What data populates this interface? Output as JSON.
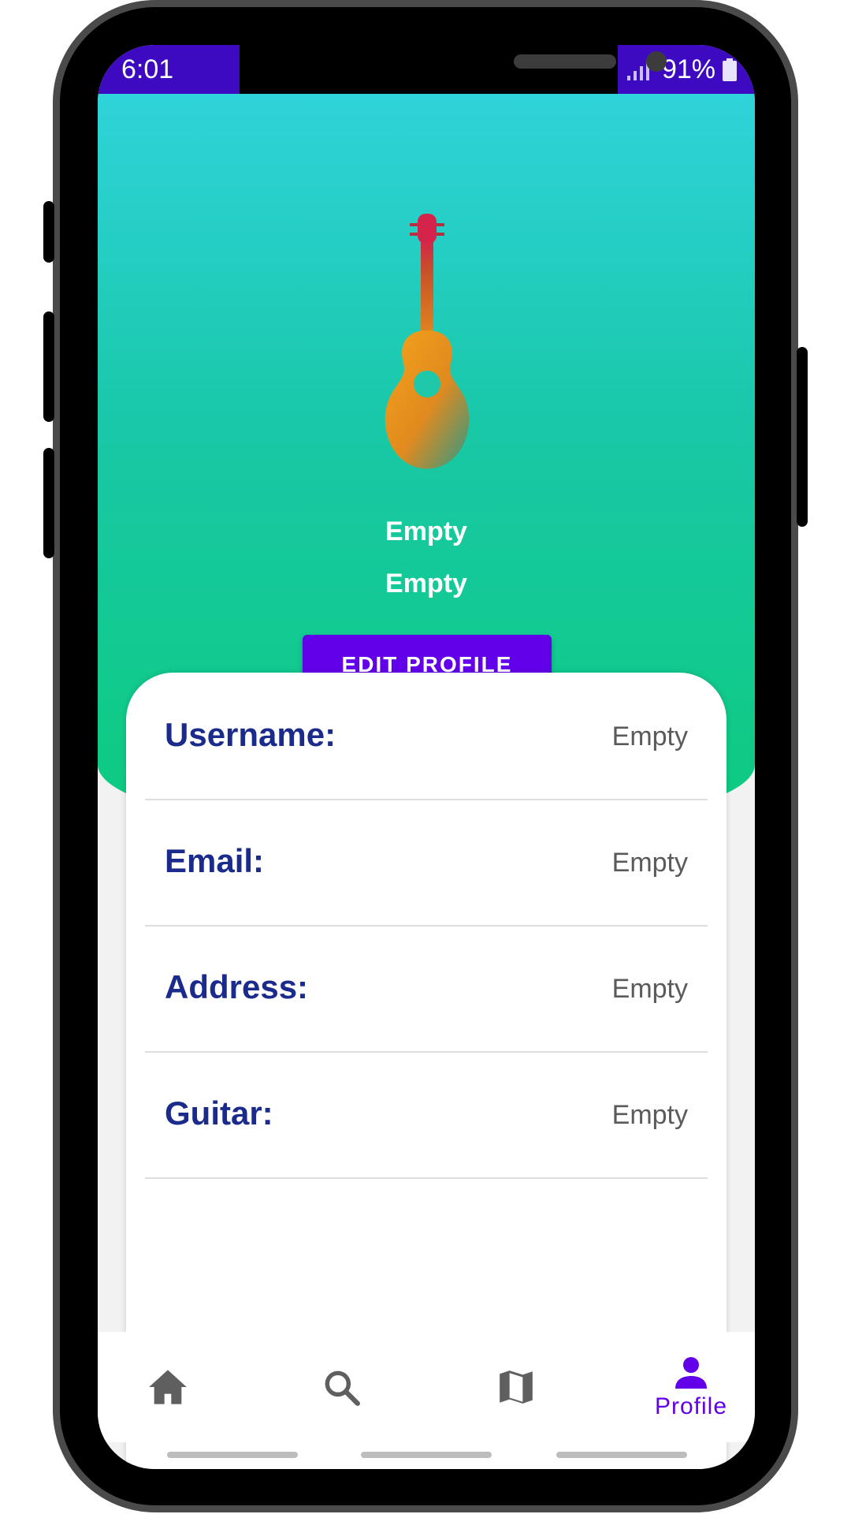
{
  "status_bar": {
    "time": "6:01",
    "battery": "91%"
  },
  "profile": {
    "name_line_1": "Empty",
    "name_line_2": "Empty",
    "edit_button": "EDIT PROFILE",
    "avatar_icon": "guitar-icon"
  },
  "fields": [
    {
      "label": "Username:",
      "value": "Empty"
    },
    {
      "label": "Email:",
      "value": "Empty"
    },
    {
      "label": "Address:",
      "value": "Empty"
    },
    {
      "label": "Guitar:",
      "value": "Empty"
    }
  ],
  "bottom_nav": {
    "items": [
      {
        "icon": "home-icon",
        "label": ""
      },
      {
        "icon": "search-icon",
        "label": ""
      },
      {
        "icon": "map-icon",
        "label": ""
      },
      {
        "icon": "person-icon",
        "label": "Profile",
        "active": true
      }
    ]
  },
  "colors": {
    "status_bar": "#3d0ac2",
    "accent": "#6200ea",
    "label_text": "#1a2b8c",
    "gradient_top": "#2fd3da",
    "gradient_bottom": "#0dcb7e"
  }
}
